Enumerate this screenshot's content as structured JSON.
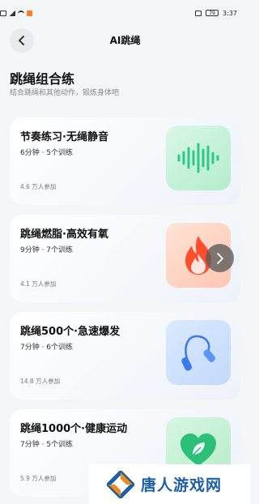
{
  "status_bar": {
    "time": "3:37",
    "battery": "79",
    "icons": [
      "hd-icon",
      "signal-icon",
      "wifi-icon",
      "app-notification-icon",
      "vibrate-icon",
      "battery-icon"
    ]
  },
  "header": {
    "title": "AI跳绳",
    "back_icon": "chevron-left-icon"
  },
  "section": {
    "title": "跳绳组合练",
    "subtitle": "结合跳绳和其他动作，锻炼身体吧"
  },
  "cards": [
    {
      "title": "节奏练习·无绳静音",
      "meta": "6分钟 · 5个训练",
      "count": "4.6 万人参加",
      "icon": "sound-wave-icon",
      "accent": "#2fc987"
    },
    {
      "title": "跳绳燃脂·高效有氧",
      "meta": "9分钟 · 7个训练",
      "count": "4.1 万人参加",
      "icon": "flame-icon",
      "accent": "#ff4e2c"
    },
    {
      "title": "跳绳500个·急速爆发",
      "meta": "7分钟 · 6个训练",
      "count": "14.8 万人参加",
      "icon": "jump-rope-icon",
      "accent": "#3b7bf0"
    },
    {
      "title": "跳绳1000个·健康运动",
      "meta": "7分钟 · 5个训练",
      "count": "5.9 万人参加",
      "icon": "heart-leaf-icon",
      "accent": "#2cbf78"
    }
  ],
  "watermark": {
    "text": "唐人游戏网"
  }
}
